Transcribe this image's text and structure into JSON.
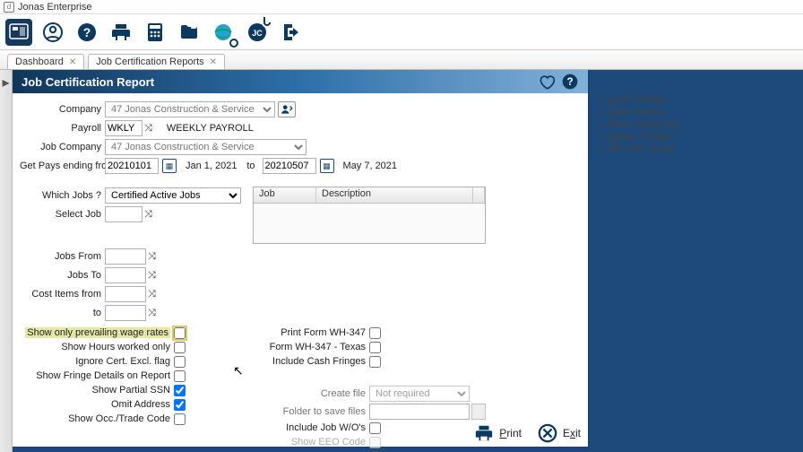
{
  "window": {
    "title": "Jonas Enterprise"
  },
  "tabs": [
    {
      "label": "Dashboard"
    },
    {
      "label": "Job Certification Reports"
    }
  ],
  "panel": {
    "title": "Job Certification Report"
  },
  "form": {
    "company_label": "Company",
    "company_value": "47 Jonas Construction & Service",
    "payroll_label": "Payroll",
    "payroll_code": "WKLY",
    "payroll_desc": "WEEKLY PAYROLL",
    "job_company_label": "Job Company",
    "job_company_value": "47 Jonas Construction & Service",
    "pays_label": "Get Pays ending from",
    "pays_from": "20210101",
    "pays_from_long": "Jan 1, 2021",
    "to_label": "to",
    "pays_to": "20210507",
    "pays_to_long": "May 7, 2021",
    "which_jobs_label": "Which Jobs ?",
    "which_jobs_value": "Certified Active Jobs",
    "select_job_label": "Select Job",
    "jobs_from_label": "Jobs From",
    "jobs_to_label": "Jobs To",
    "cost_from_label": "Cost Items from",
    "cost_to_label": "to"
  },
  "grid": {
    "col_job": "Job",
    "col_desc": "Description"
  },
  "checks_left": {
    "prevailing": "Show only prevailing wage rates",
    "hours": "Show Hours worked only",
    "ignore": "Ignore Cert. Excl. flag",
    "fringe": "Show Fringe Details on Report",
    "ssn": "Show Partial SSN",
    "omit": "Omit Address",
    "trade": "Show Occ./Trade Code"
  },
  "checks_right": {
    "wh": "Print Form WH-347",
    "tx": "Form WH-347 - Texas",
    "cash": "Include Cash Fringes",
    "create_file_label": "Create file",
    "create_file_value": "Not required",
    "folder_label": "Folder to save files",
    "include_wo": "Include Job W/O's",
    "eeo": "Show EEO Code"
  },
  "footer": {
    "print": "Print",
    "exit": "Exit"
  },
  "sidemenu": {
    "load": {
      "prefix": "» ",
      "u": "L",
      "rest": "oad Design"
    },
    "save": {
      "prefix": "» ",
      "u": "S",
      "rest": "ave Design"
    },
    "saveas": {
      "prefix": "» Save Design ",
      "u": "A",
      "rest": "s"
    },
    "delete": {
      "prefix": "» ",
      "u": "D",
      "rest": "elete Design"
    },
    "texas": {
      "prefix": "» WH-347 ",
      "u": "T",
      "rest": "exas"
    }
  }
}
